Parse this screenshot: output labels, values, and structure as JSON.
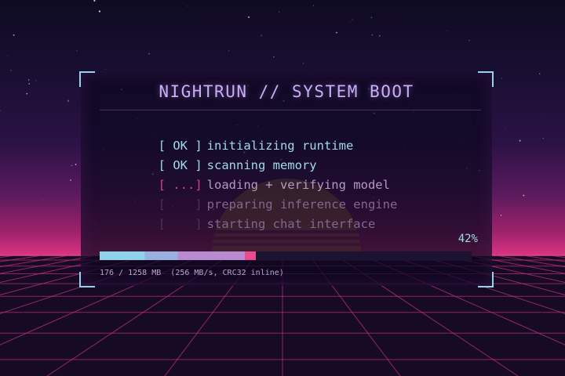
{
  "window": {
    "title": "NIGHTRUN // SYSTEM BOOT"
  },
  "boot_steps": [
    {
      "status": "[ OK ]",
      "label": "initializing runtime",
      "state": "ok"
    },
    {
      "status": "[ OK ]",
      "label": "scanning memory",
      "state": "ok"
    },
    {
      "status": "[ ...]",
      "label": "loading + verifying model",
      "state": "active"
    },
    {
      "status": "[    ]",
      "label": "preparing inference engine",
      "state": "pending"
    },
    {
      "status": "[    ]",
      "label": "starting chat interface",
      "state": "pending"
    }
  ],
  "progress": {
    "percent_label": "42%",
    "fraction": 0.42,
    "status_text": "176 / 1258 MB  (256 MB/s, CRC32 inline)"
  },
  "colors": {
    "accent": "#9fdbe6",
    "title": "#c9aef2",
    "active": "#d2437e",
    "grid": "#c0307a",
    "frame_corner": "#8fd7e8"
  },
  "icons": {
    "frame_corners": "corner-bracket-icon"
  }
}
